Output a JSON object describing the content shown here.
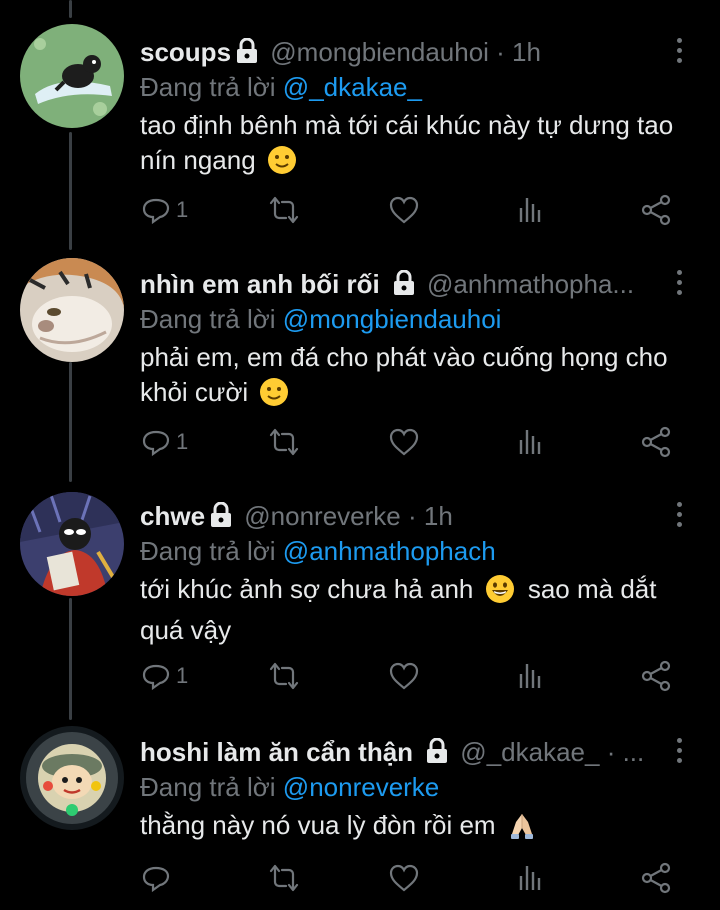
{
  "colors": {
    "background": "#000000",
    "text": "#e7e9ea",
    "muted": "#71767b",
    "accent": "#1d9bf0"
  },
  "tweets": [
    {
      "name": "scoups",
      "handle": "@mongbiendauhoi",
      "meta": "· 1h",
      "reply_prefix": "Đang trả lời",
      "reply_to": "@_dkakae_",
      "text": "tao định bênh mà tới cái khúc này tự dưng tao nín ngang",
      "emoji": "slight-smile",
      "reply_count": "1",
      "retweet_count": "",
      "like_count": ""
    },
    {
      "name": "nhìn em anh bối rối",
      "handle": "@anhmathopha...",
      "meta": "",
      "reply_prefix": "Đang trả lời",
      "reply_to": "@mongbiendauhoi",
      "text": "phải em, em đá cho phát vào cuống họng cho khỏi cười",
      "emoji": "slight-smile",
      "reply_count": "1",
      "retweet_count": "",
      "like_count": ""
    },
    {
      "name": "chwe",
      "handle": "@nonreverke",
      "meta": "· 1h",
      "reply_prefix": "Đang trả lời",
      "reply_to": "@anhmathophach",
      "text_before": "tới khúc ảnh sợ chưa hả anh",
      "text_after": "sao mà dắt quá vậy",
      "emoji": "grin",
      "reply_count": "1",
      "retweet_count": "",
      "like_count": ""
    },
    {
      "name": "hoshi làm ăn cẩn thận",
      "handle": "@_dkakae_",
      "meta": "· ...",
      "reply_prefix": "Đang trả lời",
      "reply_to": "@nonreverke",
      "text": "thằng này nó vua lỳ đòn rồi em",
      "emoji": "folded-hands",
      "reply_count": "",
      "retweet_count": "",
      "like_count": ""
    }
  ]
}
